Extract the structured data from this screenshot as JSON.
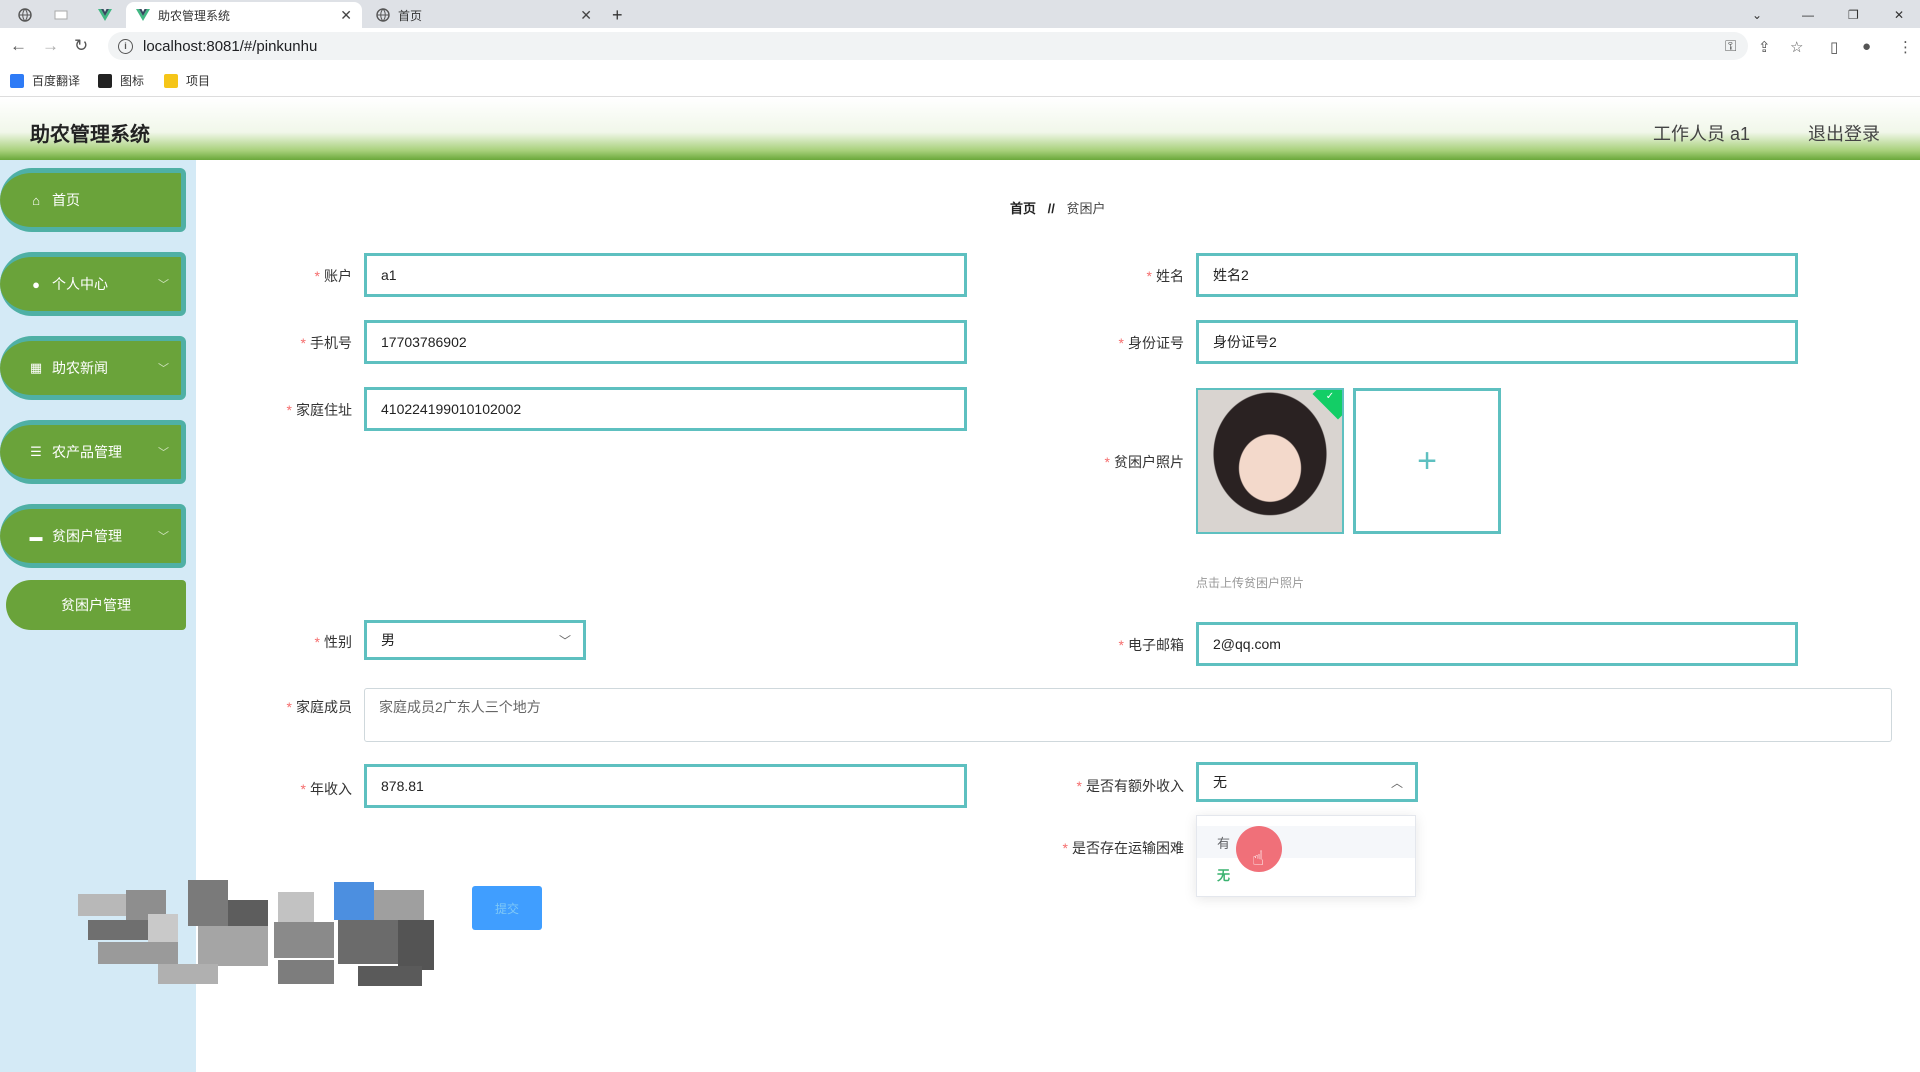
{
  "browser": {
    "tabs": [
      {
        "label": ""
      },
      {
        "label": ""
      },
      {
        "label": ""
      },
      {
        "label": "助农管理系统",
        "active": true
      },
      {
        "label": "首页"
      }
    ],
    "url": "localhost:8081/#/pinkunhu",
    "bookmarks": [
      {
        "label": "百度翻译",
        "color": "#2e7bf6"
      },
      {
        "label": "图标",
        "color": "#222222"
      },
      {
        "label": "项目",
        "color": "#f5c518"
      }
    ]
  },
  "header": {
    "title": "助农管理系统",
    "user": "工作人员 a1",
    "logout": "退出登录"
  },
  "sidebar": {
    "items": [
      {
        "label": "首页",
        "icon": "home-icon"
      },
      {
        "label": "个人中心",
        "icon": "user-icon"
      },
      {
        "label": "助农新闻",
        "icon": "grid-icon"
      },
      {
        "label": "农产品管理",
        "icon": "list-icon"
      },
      {
        "label": "贫困户管理",
        "icon": "monitor-icon"
      }
    ],
    "subitem": "贫困户管理"
  },
  "breadcrumb": {
    "home": "首页",
    "separator": "//",
    "current": "贫困户"
  },
  "form": {
    "account": {
      "label": "账户",
      "value": "a1"
    },
    "name": {
      "label": "姓名",
      "value": "姓名2"
    },
    "phone": {
      "label": "手机号",
      "value": "17703786902"
    },
    "idcard": {
      "label": "身份证号",
      "value": "身份证号2"
    },
    "address": {
      "label": "家庭住址",
      "value": "410224199010102002"
    },
    "photo": {
      "label": "贫困户照片",
      "tip": "点击上传贫困户照片",
      "add": "+"
    },
    "gender": {
      "label": "性别",
      "value": "男"
    },
    "email": {
      "label": "电子邮箱",
      "value": "2@qq.com"
    },
    "family": {
      "label": "家庭成员",
      "value": "家庭成员2广东人三个地方"
    },
    "income": {
      "label": "年收入",
      "value": "878.81"
    },
    "extra_income": {
      "label": "是否有额外收入",
      "value": "无"
    },
    "transport": {
      "label": "是否存在运输困难"
    },
    "dropdown_options": [
      "有",
      "无"
    ],
    "submit": "提交"
  },
  "colors": {
    "sidebar_item": "#6aa33a",
    "sidebar_border": "#4fb0a5",
    "input_border": "#5ec0c0",
    "required": "#f56c6c",
    "selected_option": "#3cb371",
    "button": "#409eff"
  }
}
